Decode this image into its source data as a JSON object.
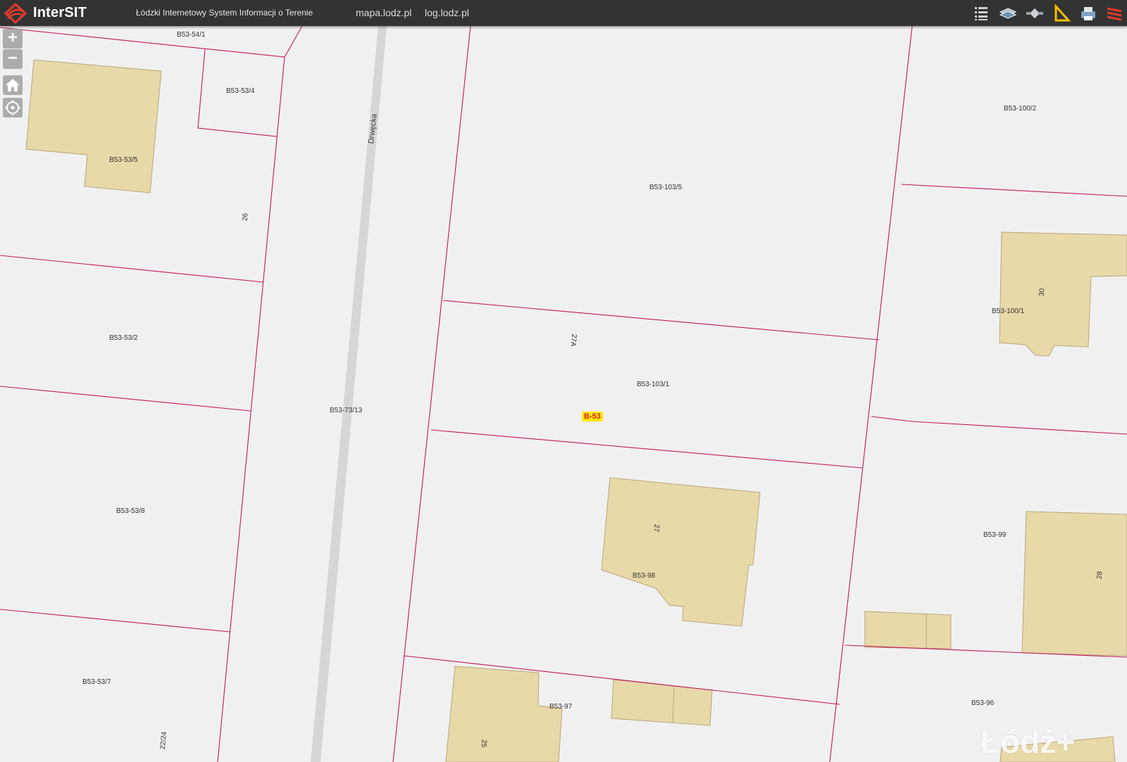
{
  "header": {
    "app_title": "InterSIT",
    "subtitle": "Łódzki Internetowy System Informacji o Terenie",
    "links": [
      "mapa.lodz.pl",
      "log.lodz.pl"
    ],
    "tools": [
      "list-icon",
      "layers-icon",
      "satellite-icon",
      "measure-icon",
      "print-icon",
      "logo-mark-icon"
    ]
  },
  "controls": {
    "zoom_in": "+",
    "zoom_out": "−",
    "home": "home-icon",
    "locate": "locate-icon"
  },
  "map": {
    "street_name": "Drwęcka",
    "area_badge": "B-53",
    "parcels": [
      "B53-54/1",
      "B53-53/4",
      "B53-53/5",
      "B53-53/2",
      "B53-53/8",
      "B53-53/7",
      "B53-73/13",
      "B53-103/5",
      "B53-103/1",
      "B53-98",
      "B53-97",
      "B53-100/2",
      "B53-100/1",
      "B53-99",
      "B53-96"
    ],
    "house_numbers": [
      "26",
      "27A",
      "27",
      "25",
      "22/24",
      "30",
      "28"
    ],
    "watermark": "Łódź+"
  },
  "colors": {
    "topbar": "#333333",
    "map_bg": "#f0f0f0",
    "parcel_line": "#c2185b",
    "building_fill": "#e8d9a8",
    "building_stroke": "#b9a77a",
    "road": "#d6d6d6",
    "badge_bg": "#ffe800",
    "badge_text": "#d62020",
    "logo_red": "#e03a2b"
  }
}
